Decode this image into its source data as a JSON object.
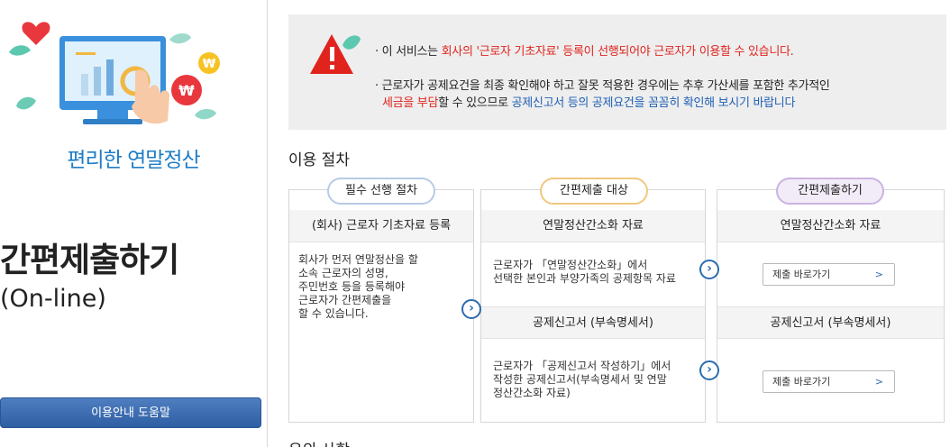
{
  "left": {
    "tagline": "편리한 연말정산",
    "title": "간편제출하기",
    "subtitle": "(On-line)",
    "help_button": "이용안내 도움말"
  },
  "notice": {
    "line1_prefix": "· 이 서비스는 ",
    "line1_red": "회사의  '근로자 기초자료'  등록이 선행되어야 근로자가 이용할 수 있습니다.",
    "line2": "· 근로자가 공제요건을 최종 확인해야 하고 잘못 적용한 경우에는 추후 가산세를 포함한 추가적인",
    "line3_red": "세금을 부담",
    "line3_mid": "할 수 있으므로 ",
    "line3_blue": "공제신고서 등의 공제요건을 꼼꼼히 확인해 보시기 바랍니다"
  },
  "procedure": {
    "title": "이용 절차",
    "col1": {
      "pill": "필수 선행 절차",
      "header": "(회사) 근로자 기초자료 등록",
      "body": [
        "회사가 먼저 연말정산을 할",
        "소속 근로자의 성명,",
        "주민번호 등을 등록해야",
        "근로자가 간편제출을",
        "할 수 있습니다."
      ]
    },
    "col2": {
      "pill": "간편제출 대상",
      "header1": "연말정산간소화 자료",
      "text1": [
        "근로자가 「연말정산간소화」에서",
        "선택한 본인과 부양가족의 공제항목 자료"
      ],
      "header2": "공제신고서 (부속명세서)",
      "text2": [
        "근로자가 「공제신고서 작성하기」에서",
        "작성한 공제신고서(부속명세서 및 연말",
        "정산간소화 자료)"
      ]
    },
    "col3": {
      "pill": "간편제출하기",
      "header1": "연말정산간소화 자료",
      "button1": "제출 바로가기",
      "header2": "공제신고서 (부속명세서)",
      "button2": "제출 바로가기"
    },
    "arrow_glyph": "›",
    "chevron_glyph": ">"
  },
  "notes": {
    "title": "유의 사항"
  },
  "colors": {
    "accent_blue": "#1f7dc6",
    "warning_red": "#e0241d",
    "link_blue": "#1e5fb4",
    "button_blue": "#2f5ea3"
  }
}
